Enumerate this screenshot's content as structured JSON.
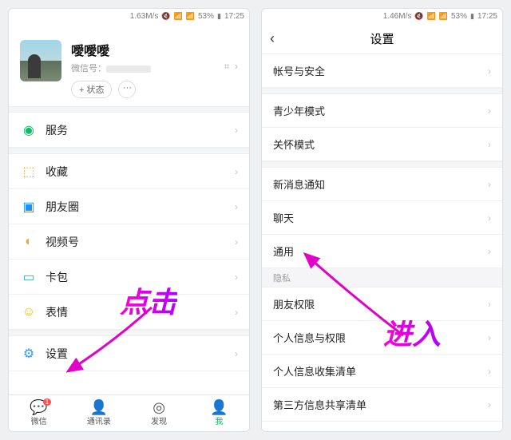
{
  "left": {
    "status": {
      "speed": "1.63M/s",
      "battery": "53%",
      "time": "17:25"
    },
    "profile": {
      "name": "噯噯噯",
      "id_label": "微信号：",
      "add_status": "+ 状态",
      "more": "···"
    },
    "rows": {
      "services": "服务",
      "favorites": "收藏",
      "moments": "朋友圈",
      "channels": "视频号",
      "cards": "卡包",
      "stickers": "表情",
      "settings": "设置"
    },
    "tabs": {
      "chat": "微信",
      "contacts": "通讯录",
      "discover": "发现",
      "me": "我",
      "chat_badge": "1"
    }
  },
  "right": {
    "status": {
      "speed": "1.46M/s",
      "battery": "53%",
      "time": "17:25"
    },
    "title": "设置",
    "rows": {
      "account": "帐号与安全",
      "teen": "青少年模式",
      "care": "关怀模式",
      "notify": "新消息通知",
      "chat": "聊天",
      "general": "通用",
      "section_privacy": "隐私",
      "friends_perm": "朋友权限",
      "personal_perm": "个人信息与权限",
      "personal_list": "个人信息收集清单",
      "thirdparty": "第三方信息共享清单"
    }
  },
  "annotations": {
    "click": "点击",
    "enter": "进入"
  }
}
